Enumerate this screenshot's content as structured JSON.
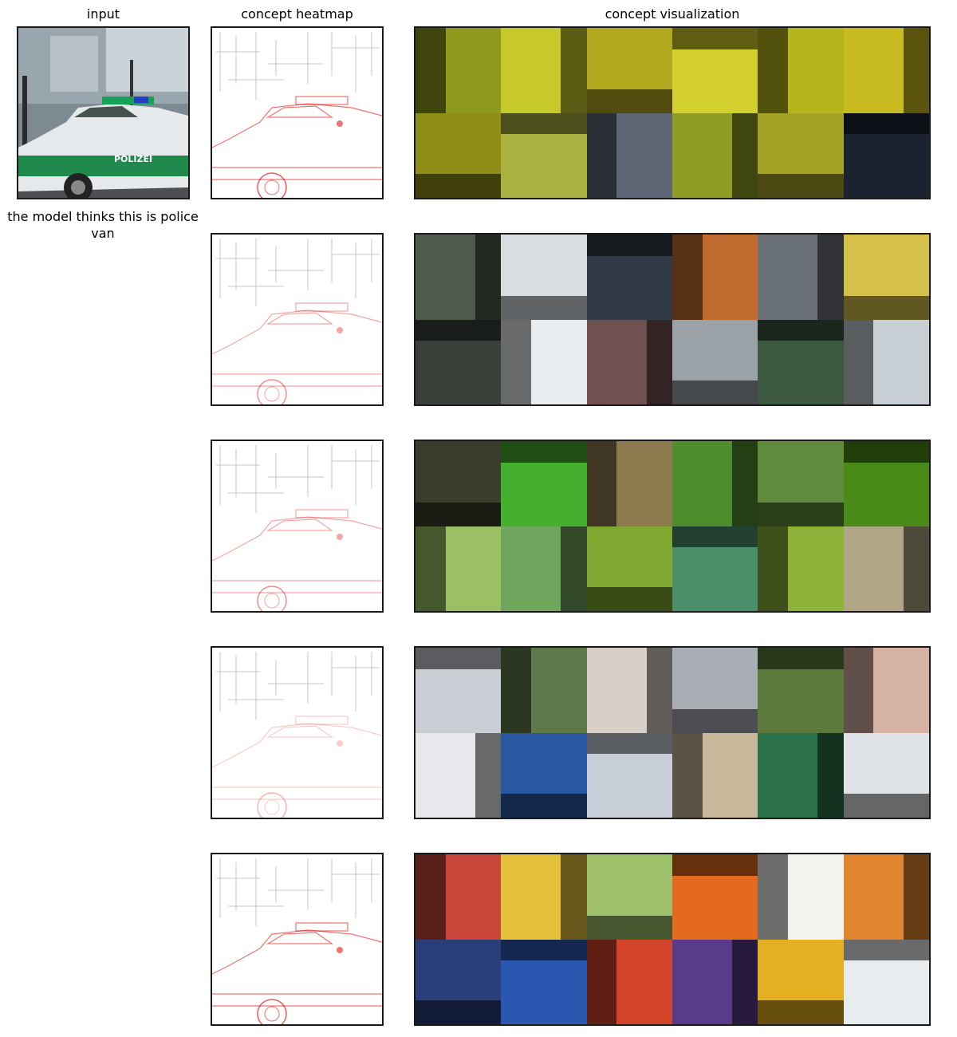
{
  "headers": {
    "input": "input",
    "heatmap": "concept heatmap",
    "visualization": "concept visualization"
  },
  "prediction_text": "the model thinks this is police van",
  "input_image": {
    "description_icon": "police-car-photo",
    "car_text": "POLIZEI"
  },
  "concept_rows": [
    {
      "heat_intensity": "high",
      "tiles": [
        "#8e9a1e",
        "#c7c928",
        "#b3a91e",
        "#d2cf2e",
        "#b5b51c",
        "#c8bb1f",
        "#8f8f18",
        "#a9b140",
        "#5d6675",
        "#8e9b24",
        "#a5a326",
        "#1c2330"
      ]
    },
    {
      "heat_intensity": "medium",
      "tiles": [
        "#4e5a4a",
        "#d8dde2",
        "#2f3a46",
        "#c06a30",
        "#6a7078",
        "#d4c04a",
        "#39403a",
        "#e9ecef",
        "#6f5150",
        "#9aa2a8",
        "#3c5840",
        "#c7cfd4"
      ]
    },
    {
      "heat_intensity": "medium",
      "tiles": [
        "#3b3d2c",
        "#45b030",
        "#8c7a4e",
        "#4f8c2c",
        "#5f8c3c",
        "#4a8a18",
        "#9ac063",
        "#6fa55c",
        "#7ea830",
        "#4a8f6a",
        "#8fb23a",
        "#b0a686"
      ]
    },
    {
      "heat_intensity": "low",
      "tiles": [
        "#c9cdd4",
        "#5f7a4a",
        "#d8d0c8",
        "#a8aeb4",
        "#5b7a3c",
        "#d6b2a2",
        "#e6e8ec",
        "#2a58a0",
        "#c7ced8",
        "#c9b89a",
        "#2a7048",
        "#dfe3e7"
      ]
    },
    {
      "heat_intensity": "high",
      "tiles": [
        "#c8453a",
        "#e6c23a",
        "#9ec06a",
        "#e36a1e",
        "#f2f2ee",
        "#e0852e",
        "#2a3e7a",
        "#2a58b0",
        "#d2452a",
        "#5a3a8a",
        "#e2b020",
        "#e8ecee"
      ]
    }
  ],
  "colors": {
    "heat_red": "#e00000",
    "frame": "#1a1a1a"
  }
}
